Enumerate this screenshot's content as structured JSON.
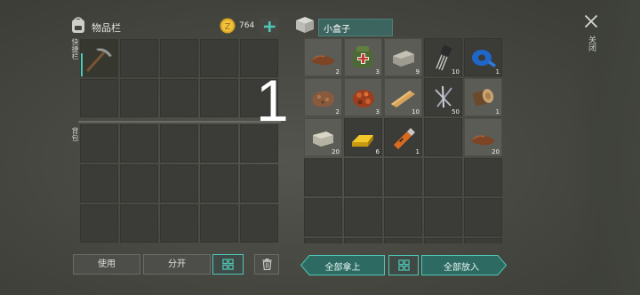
{
  "inventory": {
    "title": "物品栏",
    "coins": "764",
    "hotbar_label": "快捷栏",
    "backpack_label": "背包",
    "big_marker": "1",
    "use_button": "使用",
    "split_button": "分开"
  },
  "container": {
    "title": "小盒子",
    "take_all_button": "全部拿上",
    "put_all_button": "全部放入",
    "slots": [
      {
        "item": "leather",
        "qty": "2"
      },
      {
        "item": "first-aid-kit",
        "qty": "3"
      },
      {
        "item": "stone",
        "qty": "9"
      },
      {
        "item": "electronic-part",
        "qty": "10"
      },
      {
        "item": "duct-tape",
        "qty": "1"
      },
      {
        "item": "iron-ore",
        "qty": "2"
      },
      {
        "item": "copper-ore",
        "qty": "3"
      },
      {
        "item": "wood-plank",
        "qty": "10"
      },
      {
        "item": "nails",
        "qty": "50"
      },
      {
        "item": "log",
        "qty": "1"
      },
      {
        "item": "limestone",
        "qty": "20"
      },
      {
        "item": "gold-ingot",
        "qty": "6"
      },
      {
        "item": "usb-drive",
        "qty": "1"
      },
      {
        "item": "empty",
        "qty": ""
      },
      {
        "item": "leather",
        "qty": "20"
      }
    ]
  },
  "close": {
    "label": "关闭"
  }
}
